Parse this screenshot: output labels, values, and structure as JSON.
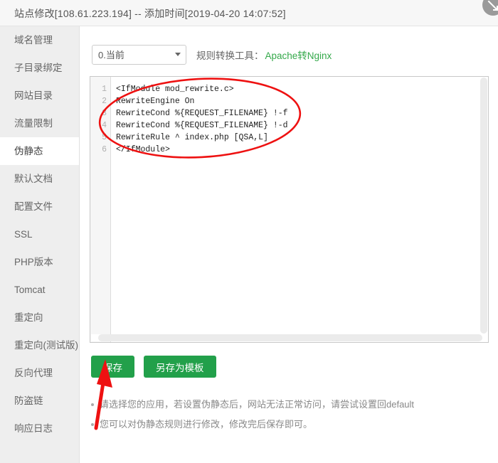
{
  "window": {
    "title": "站点修改[108.61.223.194] -- 添加时间[2019-04-20 14:07:52]",
    "expand_icon": "expand-arrow-icon"
  },
  "sidebar": {
    "items": [
      {
        "label": "域名管理",
        "active": false
      },
      {
        "label": "子目录绑定",
        "active": false
      },
      {
        "label": "网站目录",
        "active": false
      },
      {
        "label": "流量限制",
        "active": false
      },
      {
        "label": "伪静态",
        "active": true
      },
      {
        "label": "默认文档",
        "active": false
      },
      {
        "label": "配置文件",
        "active": false
      },
      {
        "label": "SSL",
        "active": false
      },
      {
        "label": "PHP版本",
        "active": false
      },
      {
        "label": "Tomcat",
        "active": false
      },
      {
        "label": "重定向",
        "active": false
      },
      {
        "label": "重定向(测试版)",
        "active": false
      },
      {
        "label": "反向代理",
        "active": false
      },
      {
        "label": "防盗链",
        "active": false
      },
      {
        "label": "响应日志",
        "active": false
      }
    ]
  },
  "toolbar": {
    "select_value": "0.当前",
    "select_options": [
      "0.当前"
    ],
    "converter_label": "规则转换工具：",
    "converter_link": "Apache转Nginx",
    "link_color": "#35a94b"
  },
  "editor": {
    "line_numbers": [
      "1",
      "2",
      "3",
      "4",
      "5",
      "6"
    ],
    "lines": [
      "<IfModule mod_rewrite.c>",
      "RewriteEngine On",
      "RewriteCond %{REQUEST_FILENAME} !-f",
      "RewriteCond %{REQUEST_FILENAME} !-d",
      "RewriteRule ^ index.php [QSA,L]",
      "</IfModule>"
    ]
  },
  "buttons": {
    "save": "保存",
    "save_as_template": "另存为模板",
    "color": "#22a04a"
  },
  "notes": [
    "请选择您的应用，若设置伪静态后，网站无法正常访问，请尝试设置回default",
    "您可以对伪静态规则进行修改，修改完后保存即可。"
  ],
  "annotations": {
    "ellipse_color": "#ee1111",
    "arrow_color": "#ee1111",
    "ellipse_name": "red-ellipse-highlight",
    "arrow_name": "red-arrow-pointer"
  }
}
